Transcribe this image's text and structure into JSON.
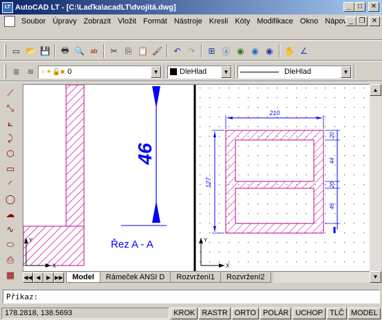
{
  "window": {
    "app_icon": "LT",
    "title": "AutoCAD LT - [C:\\Laďka\\acadLT\\dvojitá.dwg]",
    "min": "_",
    "max": "□",
    "close": "✕"
  },
  "menubar": {
    "items": [
      "Soubor",
      "Úpravy",
      "Zobrazit",
      "Vložit",
      "Formát",
      "Nástroje",
      "Kresli",
      "Kóty",
      "Modifikace",
      "Okno",
      "Nápověda"
    ],
    "doc_min": "_",
    "doc_restore": "❐",
    "doc_close": "✕"
  },
  "standard_toolbar": {
    "icons": [
      "new-icon",
      "open-icon",
      "save-icon",
      "print-icon",
      "print-preview-icon",
      "spellcheck-icon",
      "cut-icon",
      "copy-icon",
      "paste-icon",
      "match-properties-icon",
      "undo-icon",
      "redo-icon",
      "layer-icon",
      "help-icon",
      "globe-icon",
      "network-icon",
      "find-icon",
      "pan-icon",
      "zoom-icon"
    ],
    "glyphs": [
      "▭",
      "📂",
      "💾",
      "🖶",
      "🔍",
      "ab",
      "✂",
      "⎘",
      "📋",
      "🖌",
      "↶",
      "↷",
      "⊞",
      "ⓐ",
      "◉",
      "◉",
      "◉",
      "✋",
      "∠"
    ]
  },
  "object_properties_toolbar": {
    "layer_value": "0",
    "color_value": "DleHlad",
    "color_swatch": "#000000",
    "linetype_value": "DleHlad"
  },
  "draw_toolbar": {
    "icons": [
      "line-icon",
      "construction-line-icon",
      "polyline-icon",
      "arc-polyline-icon",
      "polygon-icon",
      "rectangle-icon",
      "arc-icon",
      "circle-icon",
      "revision-cloud-icon",
      "spline-icon",
      "ellipse-icon",
      "insert-block-icon",
      "make-block-icon"
    ],
    "glyphs": [
      "⟋",
      "⤡",
      "⟀",
      "⤸",
      "⬡",
      "▭",
      "◜",
      "◯",
      "☁",
      "∿",
      "⬭",
      "⎙",
      "▦"
    ]
  },
  "drawing": {
    "section_label": "Řez A - A",
    "dim_46": "46",
    "dim_210": "210",
    "dim_127": "127",
    "dim_20a": "20",
    "dim_44": "44",
    "dim_20b": "20",
    "dim_46b": "46",
    "ucs_x": "X",
    "ucs_y": "Y",
    "hatch_color": "#c0008c",
    "dim_color": "#0000ff"
  },
  "tabs": {
    "nav": [
      "◀◀",
      "◀",
      "▶",
      "▶▶"
    ],
    "items": [
      "Model",
      "Rámeček ANSI D",
      "Rozvržení1",
      "Rozvržení2"
    ],
    "active": "Model"
  },
  "command": {
    "prompt": "Příkaz:"
  },
  "status": {
    "coords": "178.2818, 138.5693",
    "buttons": [
      "KROK",
      "RASTR",
      "ORTO",
      "POLÁR",
      "UCHOP",
      "TLČ",
      "MODEL"
    ]
  }
}
